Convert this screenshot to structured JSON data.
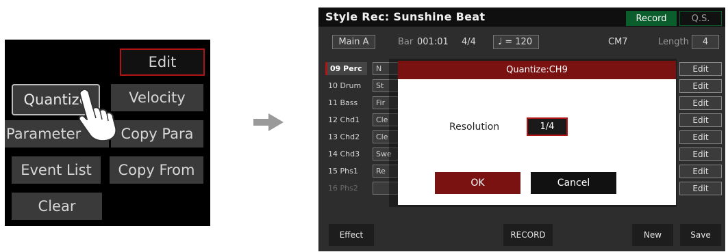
{
  "left_menu": {
    "edit": "Edit",
    "quantize": "Quantize",
    "velocity": "Velocity",
    "parameter": "Parameter",
    "copy_para": "Copy Para",
    "event_list": "Event List",
    "copy_from": "Copy From",
    "clear": "Clear"
  },
  "screen": {
    "title": "Style Rec: Sunshine Beat",
    "tabs": {
      "record": "Record",
      "qs": "Q.S."
    },
    "info": {
      "section": "Main A",
      "bar_label": "Bar",
      "bar_value": "001:01",
      "time_sig": "4/4",
      "tempo": "♩ = 120",
      "chord": "CM7",
      "length_label": "Length",
      "length_value": "4"
    },
    "tracks": [
      {
        "name": "09 Perc",
        "voice": "N",
        "edit": "Edit",
        "stub": ""
      },
      {
        "name": "10 Drum",
        "voice": "St",
        "edit": "Edit",
        "stub": ""
      },
      {
        "name": "11 Bass",
        "voice": "Fir",
        "edit": "Edit",
        "stub": ""
      },
      {
        "name": "12 Chd1",
        "voice": "Cle",
        "edit": "Edit",
        "stub": ""
      },
      {
        "name": "13 Chd2",
        "voice": "Cle",
        "edit": "Edit",
        "stub": ""
      },
      {
        "name": "14 Chd3",
        "voice": "Swe",
        "edit": "Edit",
        "stub": ""
      },
      {
        "name": "15 Phs1",
        "voice": "Re",
        "edit": "Edit",
        "stub": ""
      },
      {
        "name": "16 Phs2",
        "voice": "",
        "edit": "Edit",
        "stub": ""
      }
    ],
    "bottom": {
      "effect": "Effect",
      "record": "RECORD",
      "new": "New",
      "save": "Save"
    }
  },
  "dialog": {
    "title": "Quantize:CH9",
    "resolution_label": "Resolution",
    "resolution_value": "1/4",
    "ok": "OK",
    "cancel": "Cancel"
  },
  "colors": {
    "accent_red": "#7a1212",
    "record_tab_green": "#0c5d2c"
  }
}
